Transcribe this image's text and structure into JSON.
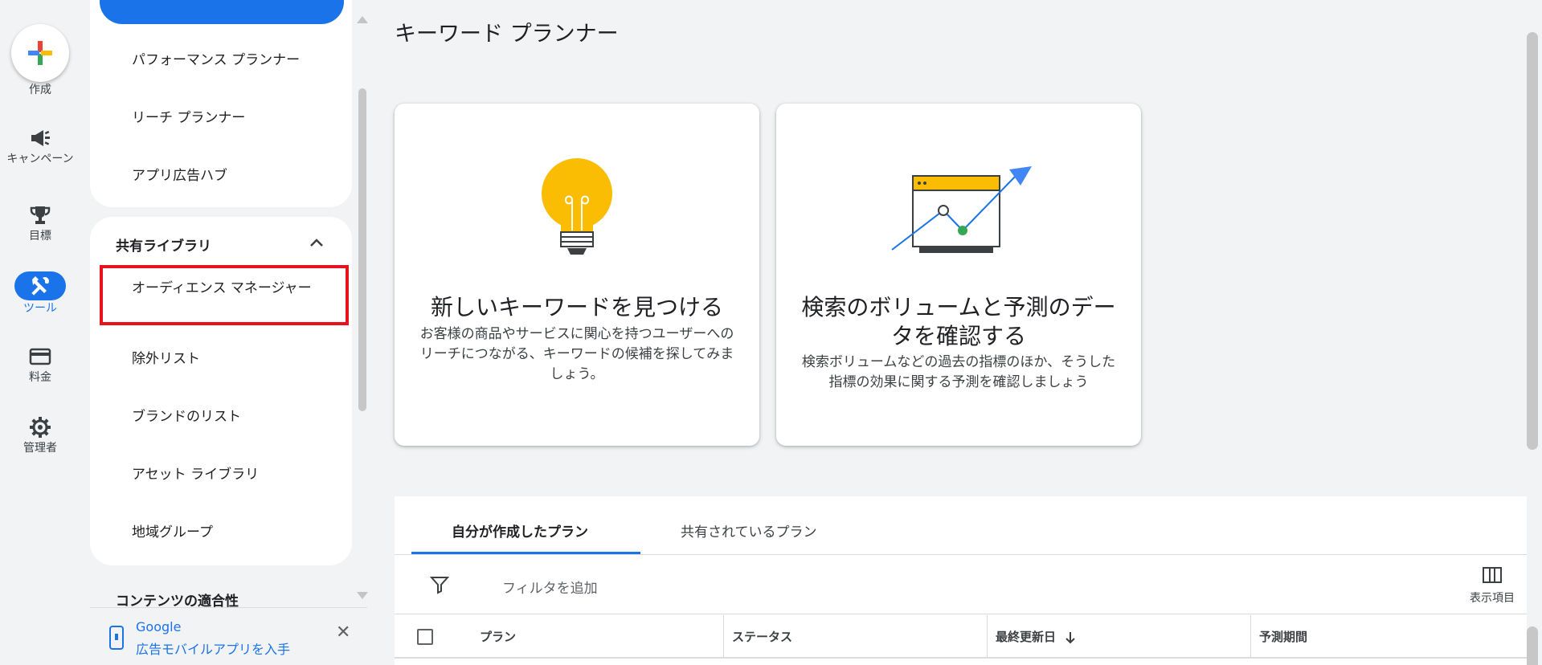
{
  "rail": {
    "create_label": "作成",
    "items": [
      {
        "label": "キャンペーン"
      },
      {
        "label": "目標"
      },
      {
        "label": "ツール"
      },
      {
        "label": "料金"
      },
      {
        "label": "管理者"
      }
    ]
  },
  "nav": {
    "top_items": [
      "パフォーマンス プランナー",
      "リーチ プランナー",
      "アプリ広告ハブ"
    ],
    "shared_library": {
      "header": "共有ライブラリ",
      "items": [
        "オーディエンス マネージャー",
        "除外リスト",
        "ブランドのリスト",
        "アセット ライブラリ",
        "地域グループ"
      ]
    },
    "content_suitability": "コンテンツの適合性"
  },
  "promo": {
    "line1": "Google",
    "line2": "広告モバイルアプリを入手"
  },
  "page": {
    "title": "キーワード プランナー"
  },
  "cards": [
    {
      "title": "新しいキーワードを見つける",
      "desc": "お客様の商品やサービスに関心を持つユーザーへのリーチにつながる、キーワードの候補を探してみましょう。"
    },
    {
      "title": "検索のボリュームと予測のデータを確認する",
      "desc": "検索ボリュームなどの過去の指標のほか、そうした指標の効果に関する予測を確認しましょう"
    }
  ],
  "tabs": [
    "自分が作成したプラン",
    "共有されているプラン"
  ],
  "filter": {
    "label": "フィルタを追加",
    "columns_label": "表示項目"
  },
  "table": {
    "columns": [
      "プラン",
      "ステータス",
      "最終更新日",
      "予測期間"
    ]
  },
  "colors": {
    "accent": "#1a73e8",
    "highlight": "#e8111e"
  }
}
